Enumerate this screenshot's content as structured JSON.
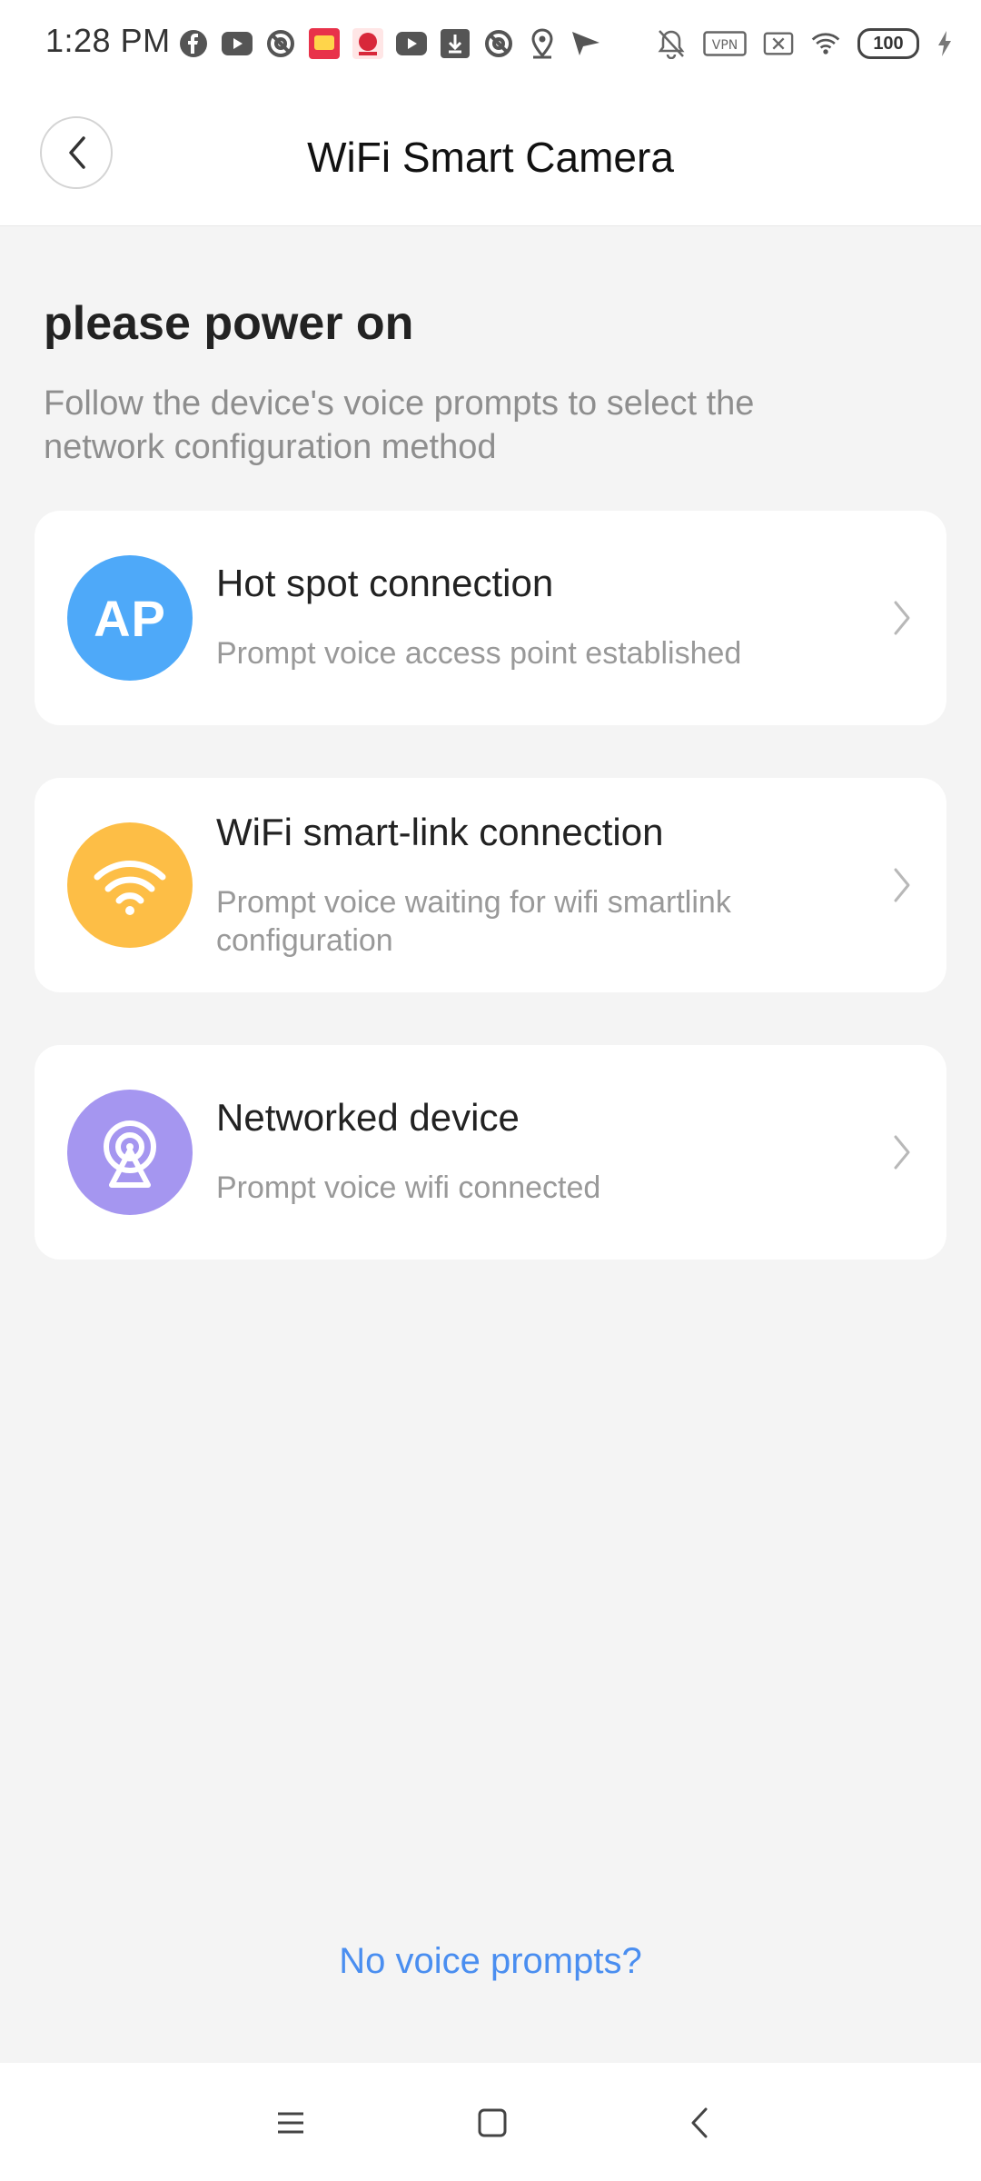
{
  "status_bar": {
    "time": "1:28 PM",
    "battery_level": "100",
    "left_icons": [
      "facebook-icon",
      "youtube-icon",
      "at-sign-icon",
      "app-badge-icon",
      "app-badge-icon",
      "youtube-icon",
      "download-icon",
      "at-sign-icon",
      "location-icon",
      "send-icon"
    ],
    "right_icons": [
      "bell-muted-icon",
      "vpn-icon",
      "sim-off-icon",
      "wifi-icon",
      "battery-icon",
      "charging-icon"
    ]
  },
  "header": {
    "title": "WiFi Smart Camera",
    "back_icon": "chevron-left-icon"
  },
  "main": {
    "heading": "please power on",
    "subtitle": "Follow the device's voice prompts to select the network configuration method",
    "options": [
      {
        "icon_label": "AP",
        "icon_color": "#4ea9f9",
        "title": "Hot spot connection",
        "description": "Prompt voice access point established"
      },
      {
        "icon_name": "wifi-icon",
        "icon_color": "#fdbe46",
        "title": "WiFi smart-link connection",
        "description": "Prompt voice waiting for wifi smartlink configuration"
      },
      {
        "icon_name": "broadcast-tower-icon",
        "icon_color": "#a596f0",
        "title": "Networked device",
        "description": "Prompt voice wifi connected"
      }
    ],
    "help_link": "No voice prompts?"
  },
  "nav_bar": {
    "items": [
      "menu-icon",
      "home-icon",
      "back-icon"
    ]
  },
  "colors": {
    "link": "#4a8ef0",
    "background": "#f4f4f4"
  }
}
